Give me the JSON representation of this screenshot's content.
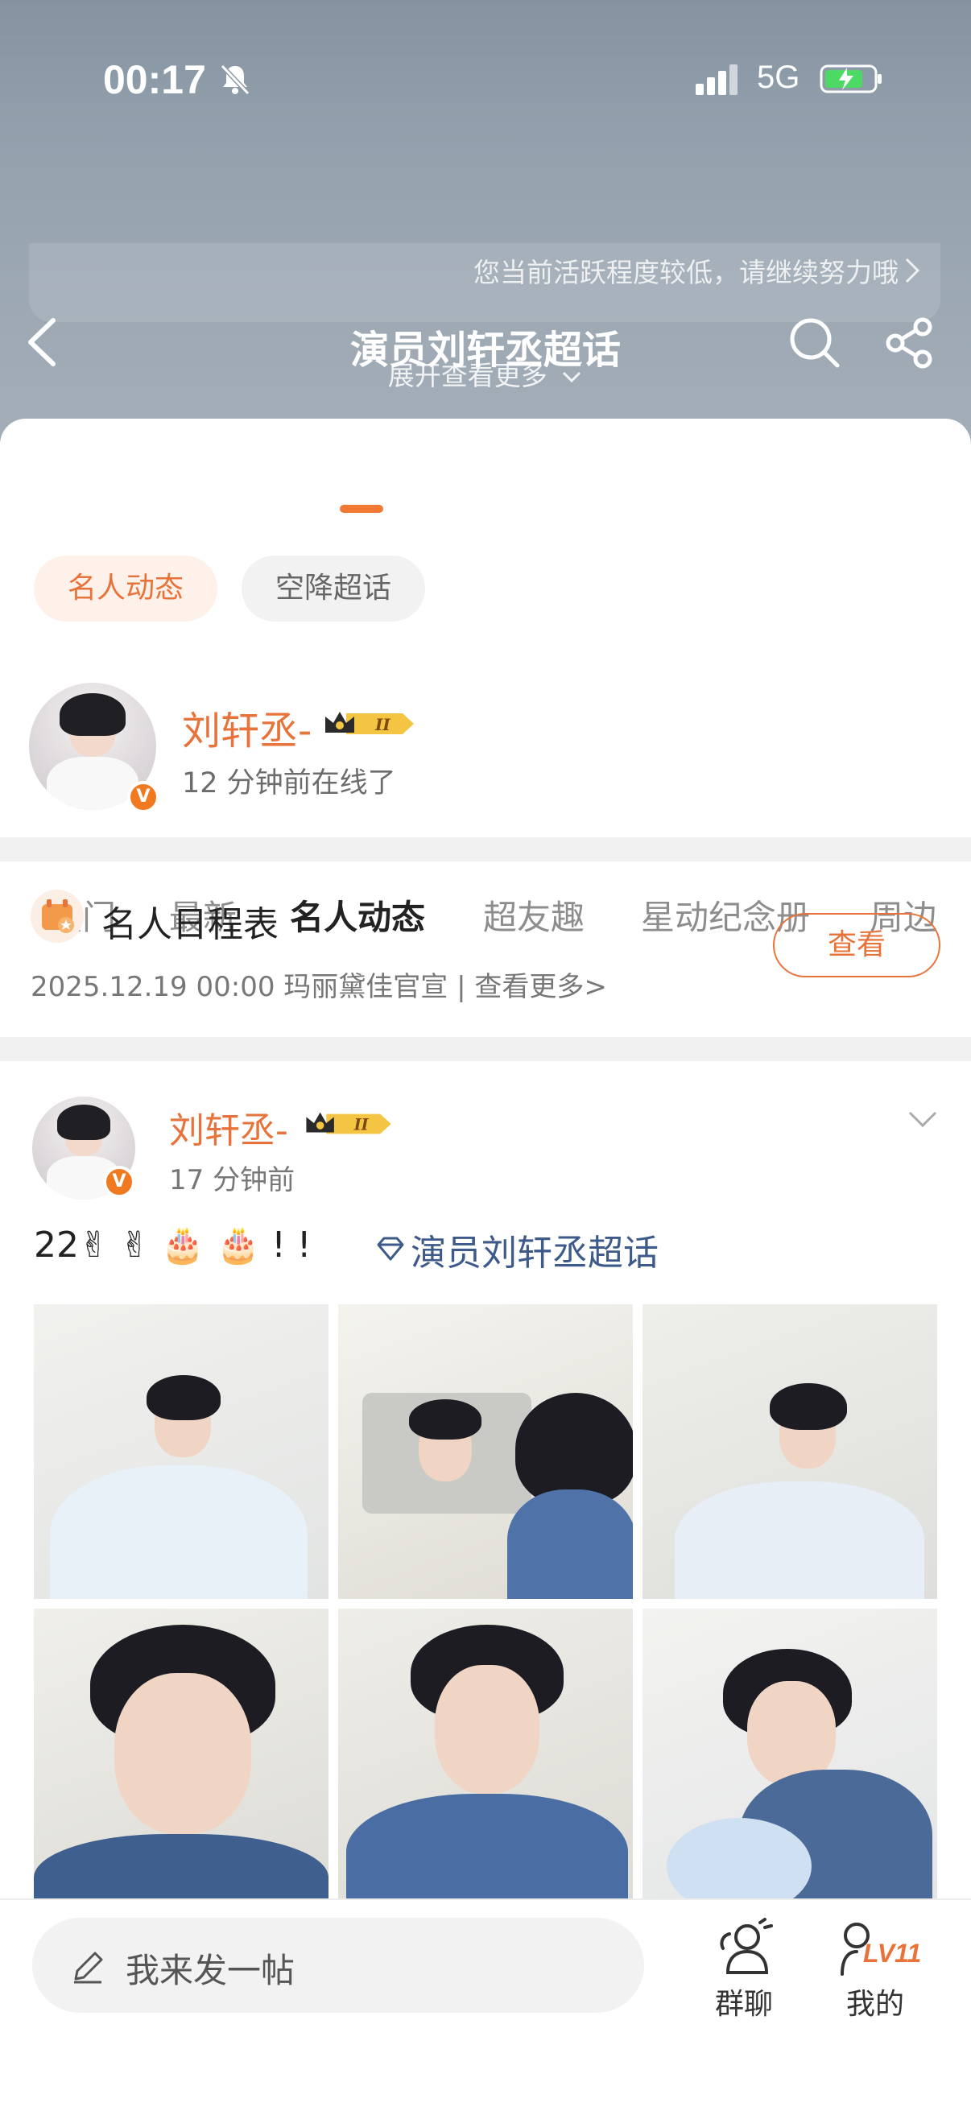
{
  "status_bar": {
    "time": "00:17",
    "network": "5G"
  },
  "nav": {
    "title": "演员刘轩丞超话"
  },
  "activity": {
    "notice": "您当前活跃程度较低，请继续努力哦",
    "expand": "展开查看更多"
  },
  "tabs": [
    {
      "label": "热门"
    },
    {
      "label": "最新"
    },
    {
      "label": "名人动态"
    },
    {
      "label": "超友趣"
    },
    {
      "label": "星动纪念册"
    },
    {
      "label": "周边"
    }
  ],
  "filters": [
    {
      "label": "名人动态",
      "active": true
    },
    {
      "label": "空降超话",
      "active": false
    }
  ],
  "celebrity": {
    "name": "刘轩丞-",
    "status": "12 分钟前在线了",
    "badge_level": "II"
  },
  "schedule": {
    "title": "名人日程表",
    "info": "2025.12.19 00:00 玛丽黛佳官宣 |  查看更多>",
    "button": "查看"
  },
  "post": {
    "author": "刘轩丞-",
    "time": "17 分钟前",
    "badge_level": "II",
    "text": "22✌ ✌ 🎂 🎂 ! !",
    "topic": "演员刘轩丞超话"
  },
  "bottom": {
    "compose_placeholder": "我来发一帖",
    "group_label": "群聊",
    "me_label": "我的",
    "level": "LV11"
  },
  "colors": {
    "accent": "#e8733a",
    "topic": "#3d5a8a",
    "header_bg": "#8d99a6"
  }
}
